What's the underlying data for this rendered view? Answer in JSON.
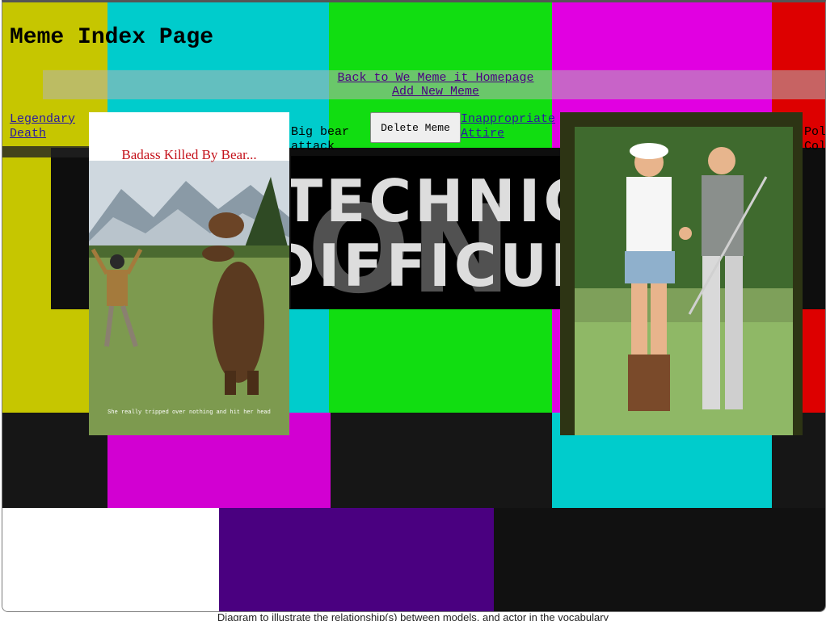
{
  "page": {
    "title": "Meme Index Page"
  },
  "nav": {
    "home_link": "Back to We Meme it Homepage",
    "add_link": "Add New Meme"
  },
  "memes": [
    {
      "name": "Legendary Death",
      "poster_headline": "Badass Killed By Bear...",
      "poster_footer": "She really tripped over nothing and hit her head"
    },
    {
      "name": "Big bear attack"
    },
    {
      "name": "Inappropriate Attire"
    },
    {
      "name": "Pol Col"
    }
  ],
  "actions": {
    "delete_label": "Delete Meme"
  },
  "background": {
    "glitch_line1": "TECHNICAL",
    "glitch_line2": "DIFFICULTY"
  },
  "caption": "Diagram to illustrate the relationship(s) between models, and actor in the vocabulary"
}
